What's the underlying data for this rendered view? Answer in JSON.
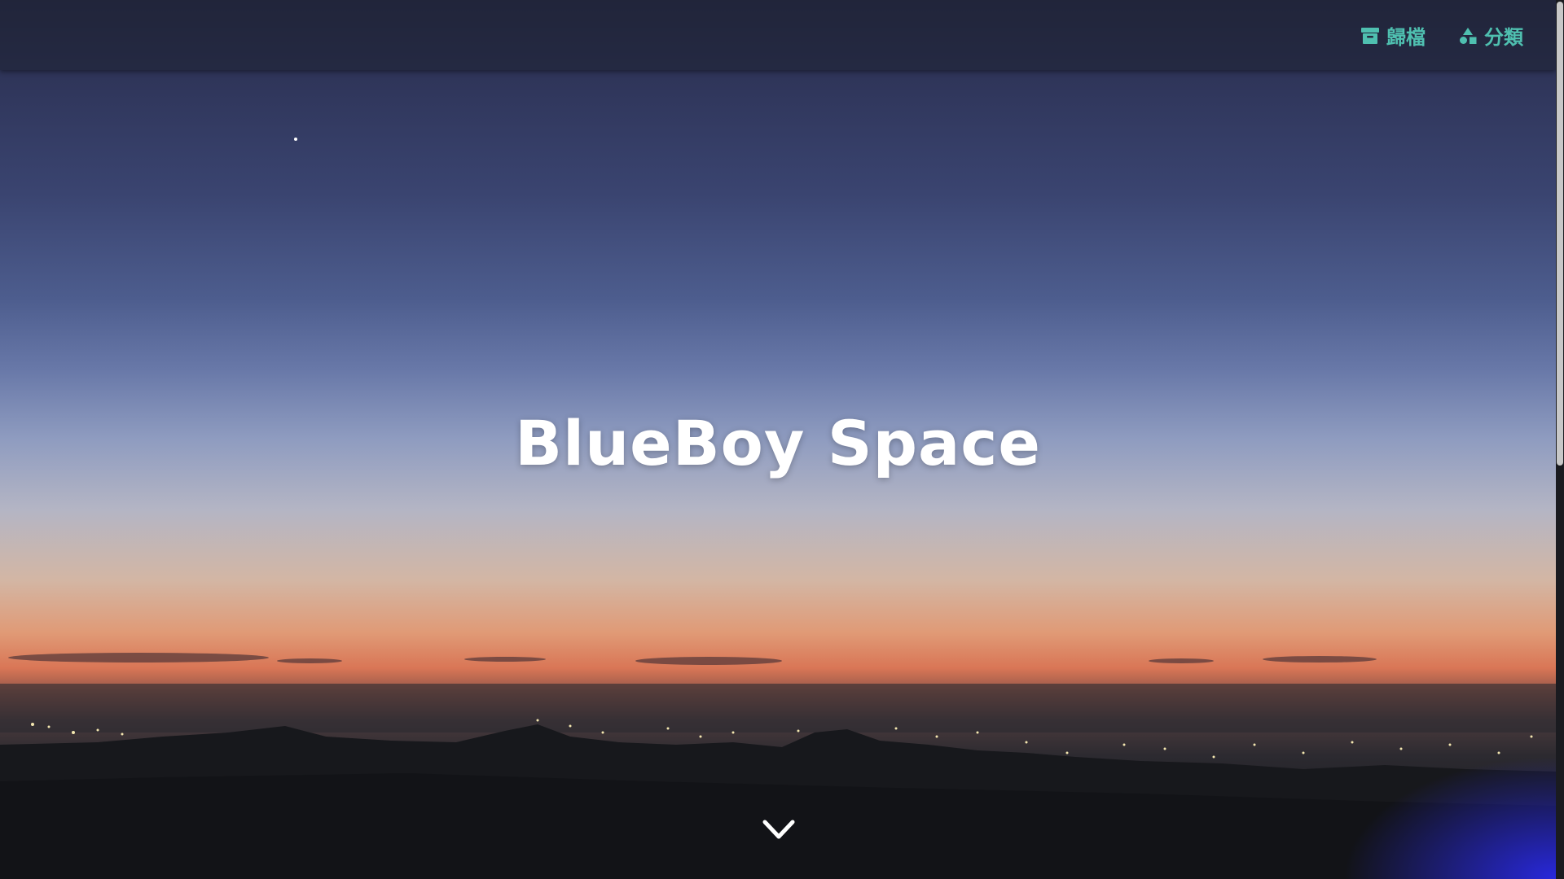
{
  "navbar": {
    "items": [
      {
        "label": "歸檔",
        "icon": "archive-icon"
      },
      {
        "label": "分類",
        "icon": "shapes-icon"
      }
    ],
    "link_color": "#4fc0b0"
  },
  "hero": {
    "title": "BlueBoy Space",
    "scroll_icon": "chevron-down-icon"
  }
}
